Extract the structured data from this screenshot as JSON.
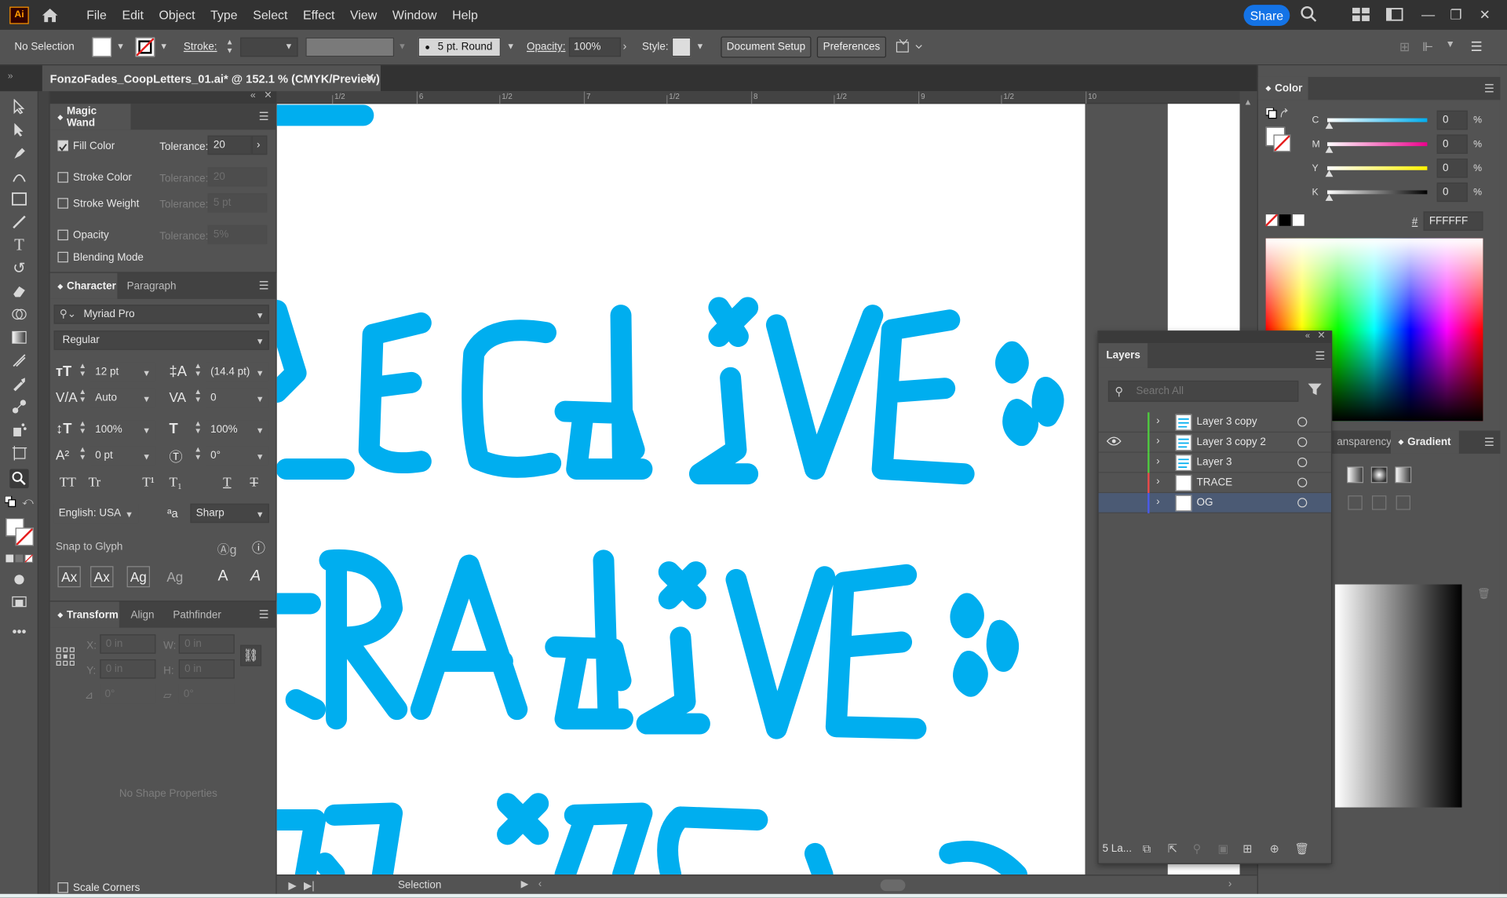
{
  "app": {
    "logo": "Ai",
    "menu": [
      "File",
      "Edit",
      "Object",
      "Type",
      "Select",
      "Effect",
      "View",
      "Window",
      "Help"
    ],
    "share_label": "Share"
  },
  "control_bar": {
    "selection_label": "No Selection",
    "stroke_label": "Stroke:",
    "brush_label": "5 pt. Round",
    "opacity_label": "Opacity:",
    "opacity_value": "100%",
    "style_label": "Style:",
    "document_setup": "Document Setup",
    "preferences": "Preferences"
  },
  "document": {
    "tab_title": "FonzoFades_CoopLetters_01.ai* @ 152.1 % (CMYK/Preview)"
  },
  "ruler_ticks": [
    "1/2",
    "6",
    "1/2",
    "7",
    "1/2",
    "8",
    "1/2",
    "9",
    "1/2",
    "10"
  ],
  "magic_wand": {
    "tab": "Magic Wand",
    "tolerance_label": "Tolerance:",
    "rows": [
      {
        "label": "Fill Color",
        "checked": true,
        "tolerance": "20"
      },
      {
        "label": "Stroke Color",
        "checked": false,
        "tolerance": "20"
      },
      {
        "label": "Stroke Weight",
        "checked": false,
        "tolerance": "5 pt"
      },
      {
        "label": "Opacity",
        "checked": false,
        "tolerance": "5%"
      },
      {
        "label": "Blending Mode",
        "checked": false
      }
    ]
  },
  "character": {
    "tabs": [
      "Character",
      "Paragraph"
    ],
    "font": "Myriad Pro",
    "style": "Regular",
    "size": "12 pt",
    "leading": "(14.4 pt)",
    "kerning": "Auto",
    "tracking": "0",
    "vscale": "100%",
    "hscale": "100%",
    "baseline": "0 pt",
    "rotation": "0°",
    "language": "English: USA",
    "antialias": "Sharp",
    "aa_icon": "ªa",
    "snap_to_glyph": "Snap to Glyph",
    "caps_buttons": [
      "TT",
      "Tr",
      "T¹",
      "T₁",
      "T",
      "T"
    ],
    "glyph_buttons": [
      "Ax",
      "Ax",
      "Ag",
      "Ag",
      "A",
      "A"
    ]
  },
  "transform": {
    "tabs": [
      "Transform",
      "Align",
      "Pathfinder"
    ],
    "x_label": "X:",
    "x_value": "0 in",
    "y_label": "Y:",
    "y_value": "0 in",
    "w_label": "W:",
    "w_value": "0 in",
    "h_label": "H:",
    "h_value": "0 in",
    "angle": "0°",
    "shear": "0°",
    "no_shape": "No Shape Properties",
    "scale_corners": "Scale Corners"
  },
  "status": {
    "tool": "Selection"
  },
  "color_panel": {
    "title": "Color",
    "channels": [
      {
        "label": "C",
        "value": "0",
        "unit": "%",
        "color": "#00aeef"
      },
      {
        "label": "M",
        "value": "0",
        "unit": "%",
        "color": "#ec008c"
      },
      {
        "label": "Y",
        "value": "0",
        "unit": "%",
        "color": "#fff200"
      },
      {
        "label": "K",
        "value": "0",
        "unit": "%",
        "color": "#000000"
      }
    ],
    "hex_label": "#",
    "hex": "FFFFFF"
  },
  "gradient_panel": {
    "tabs": [
      "ansparency",
      "Gradient"
    ]
  },
  "layers": {
    "title": "Layers",
    "search_placeholder": "Search All",
    "items": [
      {
        "name": "Layer 3 copy",
        "color": "#4fc73f",
        "visible": false,
        "selected": false
      },
      {
        "name": "Layer 3 copy 2",
        "color": "#4fc73f",
        "visible": true,
        "selected": false
      },
      {
        "name": "Layer 3",
        "color": "#4fc73f",
        "visible": false,
        "selected": false
      },
      {
        "name": "TRACE",
        "color": "#e84a4a",
        "visible": false,
        "selected": false
      },
      {
        "name": "OG",
        "color": "#4a5ae8",
        "visible": false,
        "selected": true
      }
    ],
    "count_label": "5 La..."
  },
  "colors": {
    "accent": "#1473e6",
    "artwork": "#00aeef"
  }
}
